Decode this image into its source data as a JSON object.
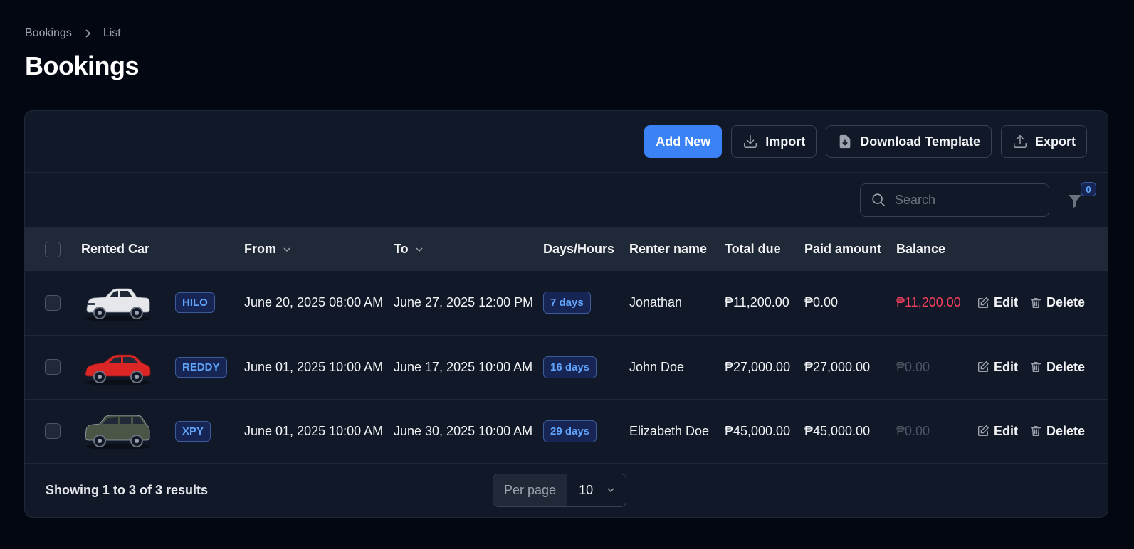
{
  "breadcrumb": {
    "parent": "Bookings",
    "current": "List"
  },
  "page_title": "Bookings",
  "toolbar": {
    "add_new": "Add New",
    "import": "Import",
    "download_template": "Download Template",
    "export": "Export"
  },
  "search": {
    "placeholder": "Search"
  },
  "filter": {
    "count": "0"
  },
  "columns": {
    "rented_car": "Rented Car",
    "from": "From",
    "to": "To",
    "days_hours": "Days/Hours",
    "renter_name": "Renter name",
    "total_due": "Total due",
    "paid_amount": "Paid amount",
    "balance": "Balance"
  },
  "actions": {
    "edit": "Edit",
    "delete": "Delete"
  },
  "rows": [
    {
      "plate": "HILO",
      "car_color": "#e5e7eb",
      "car_type": "pickup",
      "from": "June 20, 2025 08:00 AM",
      "to": "June 27, 2025 12:00 PM",
      "days": "7 days",
      "renter": "Jonathan",
      "total_due": "₱11,200.00",
      "paid": "₱0.00",
      "balance": "₱11,200.00",
      "balance_status": "due"
    },
    {
      "plate": "REDDY",
      "car_color": "#dc2626",
      "car_type": "sedan",
      "from": "June 01, 2025 10:00 AM",
      "to": "June 17, 2025 10:00 AM",
      "days": "16 days",
      "renter": "John Doe",
      "total_due": "₱27,000.00",
      "paid": "₱27,000.00",
      "balance": "₱0.00",
      "balance_status": "paid"
    },
    {
      "plate": "XPY",
      "car_color": "#4b5546",
      "car_type": "suv",
      "from": "June 01, 2025 10:00 AM",
      "to": "June 30, 2025 10:00 AM",
      "days": "29 days",
      "renter": "Elizabeth Doe",
      "total_due": "₱45,000.00",
      "paid": "₱45,000.00",
      "balance": "₱0.00",
      "balance_status": "paid"
    }
  ],
  "footer": {
    "showing": "Showing 1 to 3 of 3 results",
    "per_page_label": "Per page",
    "per_page_value": "10"
  },
  "colors": {
    "background": "#030712",
    "card": "#111827",
    "accent": "#3b82f6",
    "danger": "#f43f5e",
    "badge_text": "#60a5fa"
  }
}
